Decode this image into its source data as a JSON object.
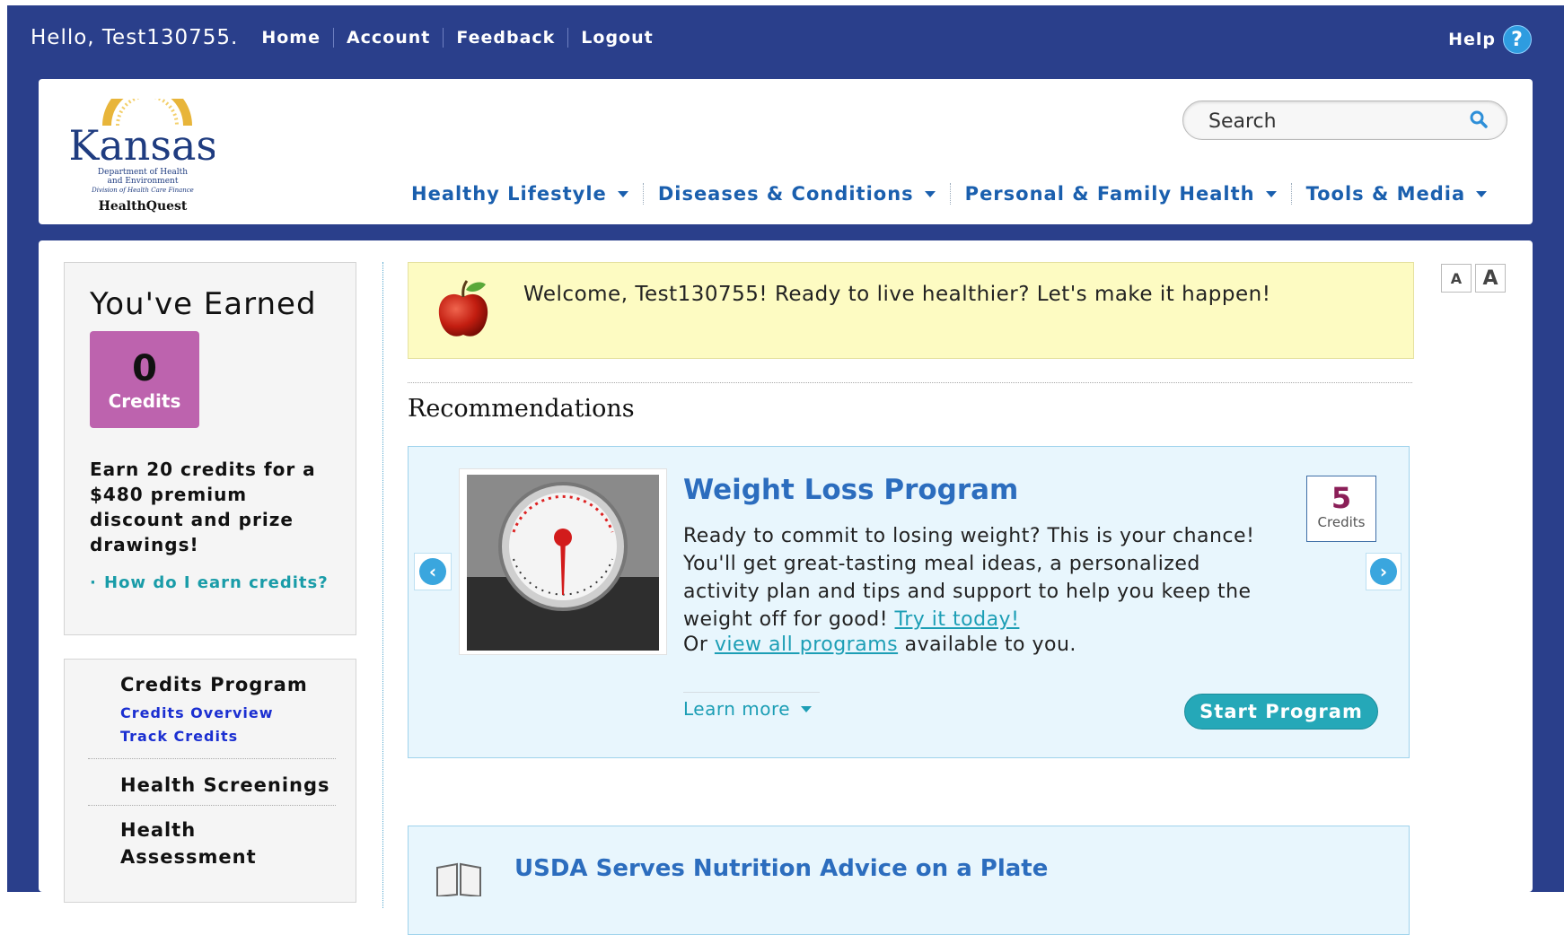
{
  "topbar": {
    "greeting": "Hello, Test130755.",
    "links": [
      "Home",
      "Account",
      "Feedback",
      "Logout"
    ],
    "help_label": "Help",
    "help_icon": "?"
  },
  "logo": {
    "name": "Kansas",
    "line1": "Department of Health",
    "line2": "and Environment",
    "line3": "Division of Health Care Finance",
    "product": "HealthQuest"
  },
  "search": {
    "placeholder": "Search"
  },
  "mainnav": [
    "Healthy Lifestyle",
    "Diseases & Conditions",
    "Personal & Family Health",
    "Tools & Media"
  ],
  "earned": {
    "title": "You've Earned",
    "credits_value": "0",
    "credits_label": "Credits",
    "earn_text": "Earn 20 credits for a $480 premium discount and prize drawings!",
    "how_link": "How do I earn credits?"
  },
  "sidenav": {
    "credits_program": "Credits Program",
    "credits_overview": "Credits Overview",
    "track_credits": "Track Credits",
    "health_screenings": "Health Screenings",
    "health_assessment_1": "Health",
    "health_assessment_2": "Assessment"
  },
  "welcome": {
    "message": "Welcome, Test130755! Ready to live healthier? Let's make it happen!"
  },
  "font_size": {
    "small": "A",
    "large": "A"
  },
  "recommendations": {
    "title": "Recommendations",
    "program": {
      "title": "Weight Loss Program",
      "description": "Ready to commit to losing weight? This is your chance! You'll get great-tasting meal ideas, a personalized activity plan and tips and support to help you keep the weight off for good!",
      "try_link": "Try it today!",
      "or_text": "Or",
      "view_link": "view all programs",
      "available_text": "available to you.",
      "credits_value": "5",
      "credits_label": "Credits",
      "learn_more": "Learn more",
      "start_button": "Start Program",
      "prev_icon": "‹",
      "next_icon": "›"
    },
    "article": {
      "title": "USDA Serves Nutrition Advice on a Plate"
    }
  },
  "colors": {
    "frame": "#2a3f8b",
    "nav_link": "#1a5fae",
    "credits_badge": "#bd63ae",
    "welcome_bg": "#fdfbc2",
    "card_bg": "#e8f6fd",
    "start_button": "#25a8b8"
  }
}
